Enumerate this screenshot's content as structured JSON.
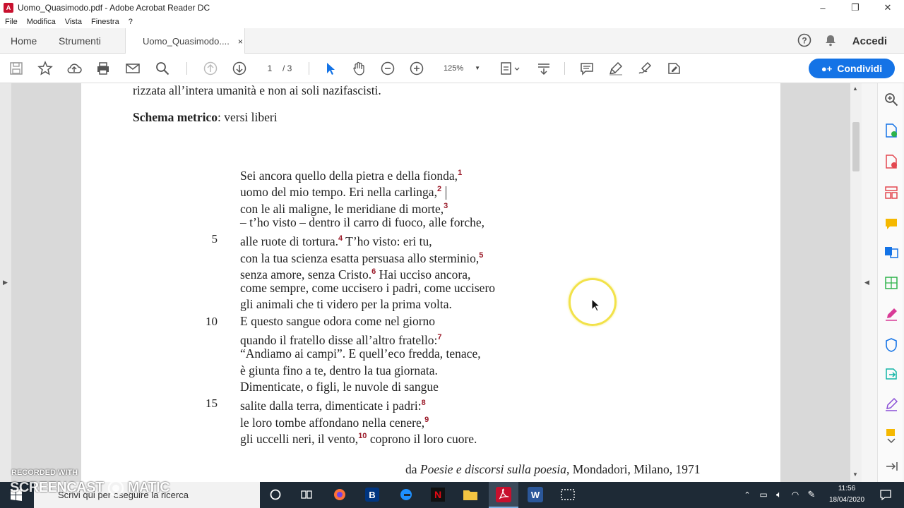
{
  "window": {
    "title": "Uomo_Quasimodo.pdf - Adobe Acrobat Reader DC",
    "app_icon": "acrobat-icon",
    "controls": [
      "–",
      "❐",
      "✕"
    ]
  },
  "menu": [
    "File",
    "Modifica",
    "Vista",
    "Finestra",
    "?"
  ],
  "tabs": {
    "home": "Home",
    "tools": "Strumenti",
    "document": "Uomo_Quasimodo....",
    "close": "×"
  },
  "header_right": {
    "signin": "Accedi"
  },
  "toolbar": {
    "page_current": "1",
    "page_total": "/ 3",
    "zoom": "125%",
    "share": "Condividi"
  },
  "document": {
    "intro_line": "rizzata all’intera umanità e non ai soli nazifascisti.",
    "schema_label": "Schema metrico",
    "schema_value": ": versi liberi",
    "verses": [
      {
        "num": "",
        "text": "Sei ancora quello della pietra e della fionda,",
        "note": "1",
        "after": ""
      },
      {
        "num": "",
        "text": "uomo del mio tempo. Eri nella carlinga,",
        "note": "2",
        "after": ""
      },
      {
        "num": "",
        "text": "con le ali maligne, le meridiane di morte,",
        "note": "3",
        "after": ""
      },
      {
        "num": "",
        "text": "– t’ho visto – dentro il carro di fuoco, alle forche,",
        "note": "",
        "after": ""
      },
      {
        "num": "5",
        "text": "alle ruote di tortura.",
        "note": "4",
        "after": " T’ho visto: eri tu,"
      },
      {
        "num": "",
        "text": "con la tua scienza esatta persuasa allo sterminio,",
        "note": "5",
        "after": ""
      },
      {
        "num": "",
        "text": "senza amore, senza Cristo.",
        "note": "6",
        "after": " Hai ucciso ancora,"
      },
      {
        "num": "",
        "text": "come sempre, come uccisero i padri, come uccisero",
        "note": "",
        "after": ""
      },
      {
        "num": "",
        "text": "gli animali che ti videro per la prima volta.",
        "note": "",
        "after": ""
      },
      {
        "num": "10",
        "text": "E questo sangue odora come nel giorno",
        "note": "",
        "after": ""
      },
      {
        "num": "",
        "text": "quando il fratello disse all’altro fratello:",
        "note": "7",
        "after": ""
      },
      {
        "num": "",
        "text": "“Andiamo ai campi”. E quell’eco fredda, tenace,",
        "note": "",
        "after": ""
      },
      {
        "num": "",
        "text": "è giunta fino a te, dentro la tua giornata.",
        "note": "",
        "after": ""
      },
      {
        "num": "",
        "text": "Dimenticate, o figli, le nuvole di sangue",
        "note": "",
        "after": ""
      },
      {
        "num": "15",
        "text": "salite dalla terra, dimenticate i padri:",
        "note": "8",
        "after": ""
      },
      {
        "num": "",
        "text": "le loro tombe affondano nella cenere,",
        "note": "9",
        "after": ""
      },
      {
        "num": "",
        "text": "gli uccelli neri, il vento,",
        "note": "10",
        "after": " coprono il loro cuore."
      }
    ],
    "source_prefix": "da ",
    "source_title": "Poesie e discorsi sulla poesia",
    "source_rest": ", Mondadori, Milano, 1971"
  },
  "taskbar": {
    "search_placeholder": "Scrivi qui per eseguire la ricerca",
    "time": "11:56",
    "date": "18/04/2020"
  },
  "watermark": {
    "line1": "RECORDED WITH",
    "line2": "SCREENCAST",
    "line3": "MATIC"
  },
  "colors": {
    "accent": "#1473e6",
    "footnote": "#9b1b2a",
    "highlight": "#f2e24a"
  }
}
